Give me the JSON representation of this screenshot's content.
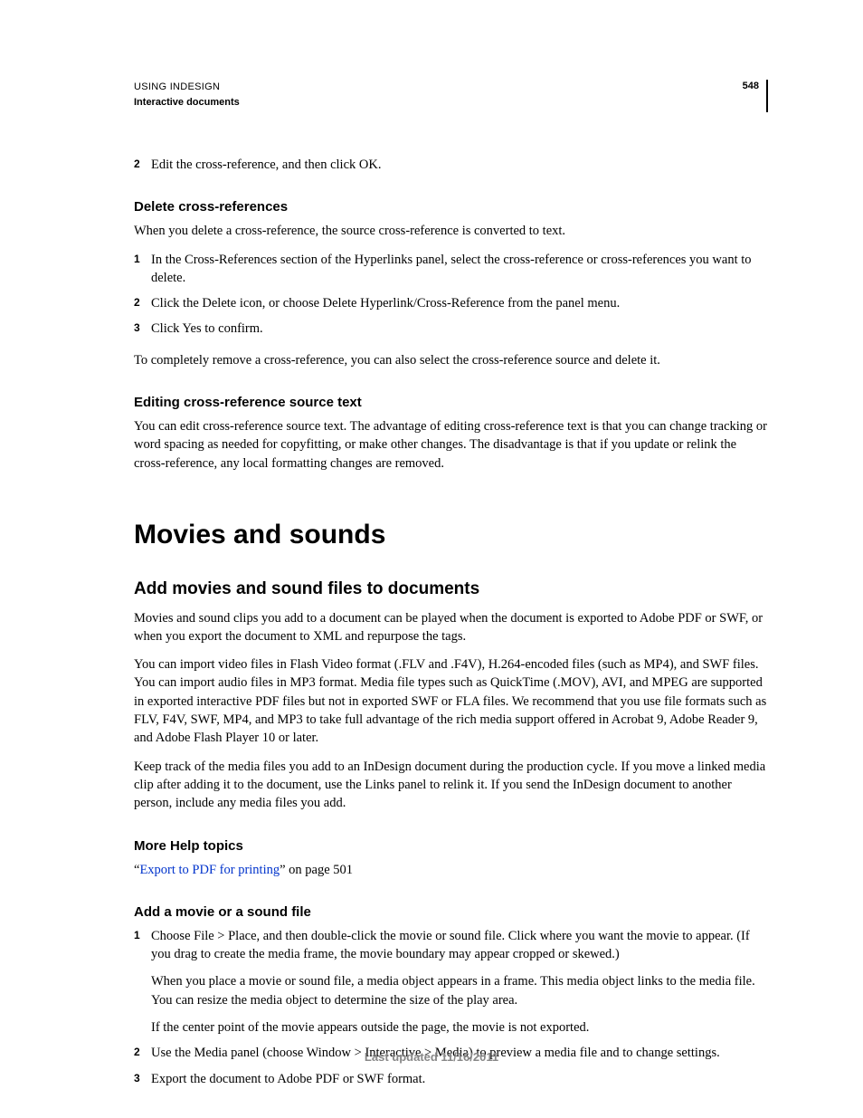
{
  "header": {
    "line1": "USING INDESIGN",
    "line2": "Interactive documents",
    "page": "548"
  },
  "intro_step": {
    "num": "2",
    "text": "Edit the cross-reference, and then click OK."
  },
  "s1": {
    "heading": "Delete cross-references",
    "intro": "When you delete a cross-reference, the source cross-reference is converted to text.",
    "steps": [
      {
        "num": "1",
        "text": "In the Cross-References section of the Hyperlinks panel, select the cross-reference or cross-references you want to delete."
      },
      {
        "num": "2",
        "text": "Click the Delete icon, or choose Delete Hyperlink/Cross-Reference from the panel menu."
      },
      {
        "num": "3",
        "text": "Click Yes to confirm."
      }
    ],
    "outro": "To completely remove a cross-reference, you can also select the cross-reference source and delete it."
  },
  "s2": {
    "heading": "Editing cross-reference source text",
    "para": "You can edit cross-reference source text. The advantage of editing cross-reference text is that you can change tracking or word spacing as needed for copyfitting, or make other changes. The disadvantage is that if you update or relink the cross-reference, any local formatting changes are removed."
  },
  "main": {
    "heading": "Movies and sounds",
    "sub": "Add movies and sound files to documents",
    "p1": "Movies and sound clips you add to a document can be played when the document is exported to Adobe PDF or SWF, or when you export the document to XML and repurpose the tags.",
    "p2": "You can import video files in Flash Video format (.FLV and .F4V), H.264-encoded files (such as MP4), and SWF files. You can import audio files in MP3 format. Media file types such as QuickTime (.MOV), AVI, and MPEG are supported in exported interactive PDF files but not in exported SWF or FLA files. We recommend that you use file formats such as FLV, F4V, SWF, MP4, and MP3 to take full advantage of the rich media support offered in Acrobat 9, Adobe Reader 9, and Adobe Flash Player 10 or later.",
    "p3": "Keep track of the media files you add to an InDesign document during the production cycle. If you move a linked media clip after adding it to the document, use the Links panel to relink it. If you send the InDesign document to another person, include any media files you add."
  },
  "help": {
    "heading": "More Help topics",
    "q1": "“",
    "link": "Export to PDF for printing",
    "q2": "” on page 501"
  },
  "s3": {
    "heading": "Add a movie or a sound file",
    "steps": [
      {
        "num": "1",
        "text": "Choose File > Place, and then double-click the movie or sound file. Click where you want the movie to appear. (If you drag to create the media frame, the movie boundary may appear cropped or skewed.)",
        "sub1": "When you place a movie or sound file, a media object appears in a frame. This media object links to the media file. You can resize the media object to determine the size of the play area.",
        "sub2": "If the center point of the movie appears outside the page, the movie is not exported."
      },
      {
        "num": "2",
        "text": "Use the Media panel (choose Window > Interactive > Media) to preview a media file and to change settings."
      },
      {
        "num": "3",
        "text": "Export the document to Adobe PDF or SWF format."
      }
    ]
  },
  "footer": "Last updated 11/16/2011"
}
